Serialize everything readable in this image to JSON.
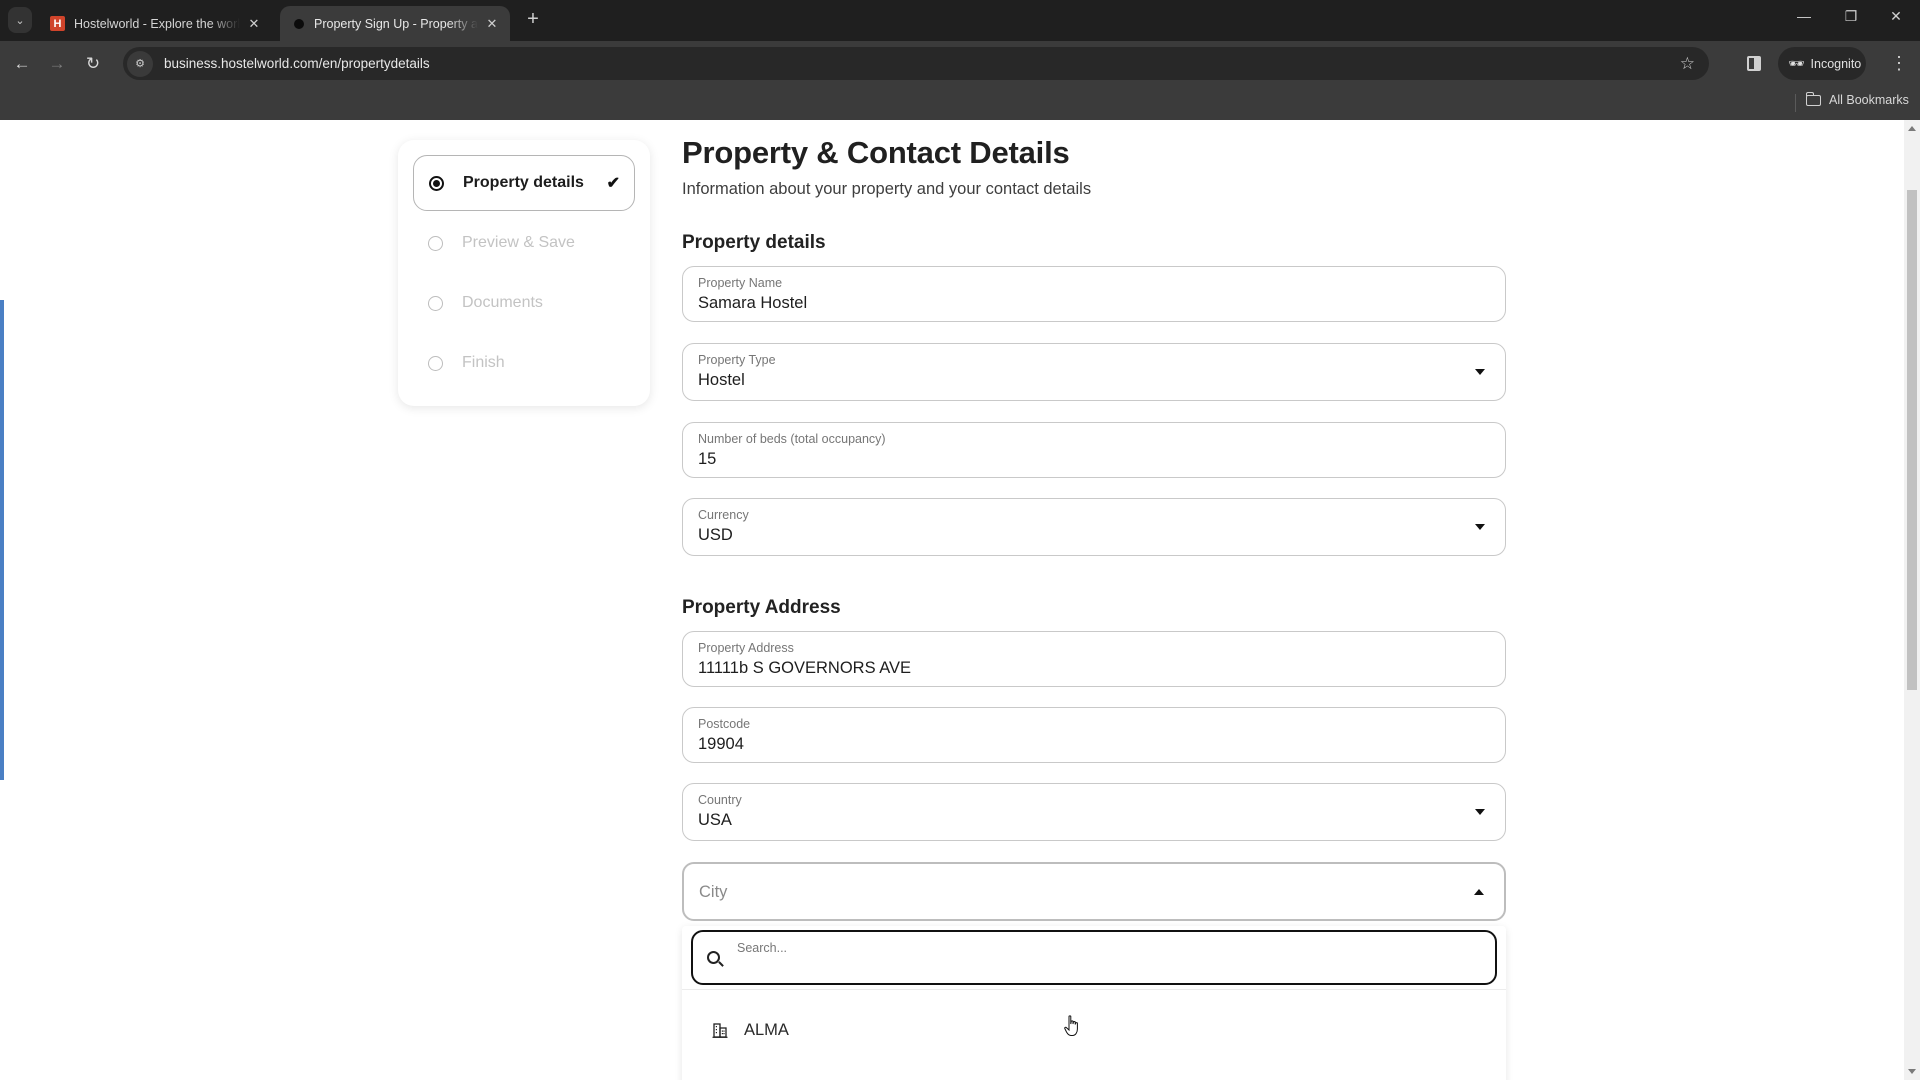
{
  "browser": {
    "tabs": [
      {
        "title": "Hostelworld - Explore the world",
        "favicon": "hostelworld-h-icon",
        "active": false
      },
      {
        "title": "Property Sign Up - Property and Contact Details",
        "favicon": "loading-dot-icon",
        "active": true
      }
    ],
    "new_tab_label": "+",
    "window_controls": {
      "minimize": "—",
      "restore": "❐",
      "close": "✕"
    },
    "nav": {
      "back": "←",
      "forward": "→",
      "reload": "↻"
    },
    "url": "business.hostelworld.com/en/propertydetails",
    "incognito_label": "Incognito",
    "all_bookmarks_label": "All Bookmarks"
  },
  "stepper": {
    "steps": [
      {
        "label": "Property details",
        "state": "active",
        "completed": true
      },
      {
        "label": "Preview & Save",
        "state": "pending"
      },
      {
        "label": "Documents",
        "state": "pending"
      },
      {
        "label": "Finish",
        "state": "pending"
      }
    ],
    "check_glyph": "✔"
  },
  "form": {
    "title": "Property & Contact Details",
    "subtitle": "Information about your property and your contact details",
    "sections": {
      "property_details": "Property details",
      "property_address": "Property Address"
    },
    "fields": {
      "property_name": {
        "label": "Property Name",
        "value": "Samara Hostel"
      },
      "property_type": {
        "label": "Property Type",
        "value": "Hostel"
      },
      "beds": {
        "label": "Number of beds (total occupancy)",
        "value": "15"
      },
      "currency": {
        "label": "Currency",
        "value": "USD"
      },
      "address": {
        "label": "Property Address",
        "value": "11111b S GOVERNORS AVE"
      },
      "postcode": {
        "label": "Postcode",
        "value": "19904"
      },
      "country": {
        "label": "Country",
        "value": "USA"
      },
      "city": {
        "placeholder": "City",
        "value": ""
      }
    },
    "city_dropdown": {
      "search_placeholder": "Search...",
      "options": [
        {
          "label": "ALMA",
          "icon": "building-icon"
        }
      ]
    }
  },
  "colors": {
    "left_accent": "#4a7fc4",
    "chrome_dark": "#1f1f1f",
    "chrome_toolbar": "#3b3b3b"
  }
}
